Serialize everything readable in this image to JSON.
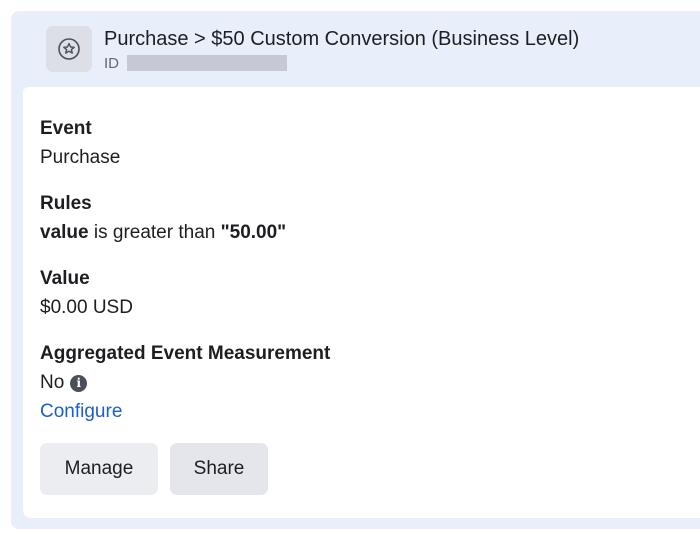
{
  "header": {
    "icon": "star-circle-icon",
    "title": "Purchase > $50 Custom Conversion (Business Level)",
    "id_label": "ID"
  },
  "fields": {
    "event": {
      "label": "Event",
      "value": "Purchase"
    },
    "rules": {
      "label": "Rules",
      "field": "value",
      "operator": " is greater than ",
      "threshold": "\"50.00\""
    },
    "value": {
      "label": "Value",
      "value": "$0.00 USD"
    },
    "aem": {
      "label": "Aggregated Event Measurement",
      "value": "No",
      "info_icon": "info-icon",
      "configure_label": "Configure"
    }
  },
  "actions": {
    "manage_label": "Manage",
    "share_label": "Share"
  },
  "colors": {
    "panel_background": "#e9eefb",
    "link": "#1a5fcc",
    "button_background": "#ebedf0"
  }
}
